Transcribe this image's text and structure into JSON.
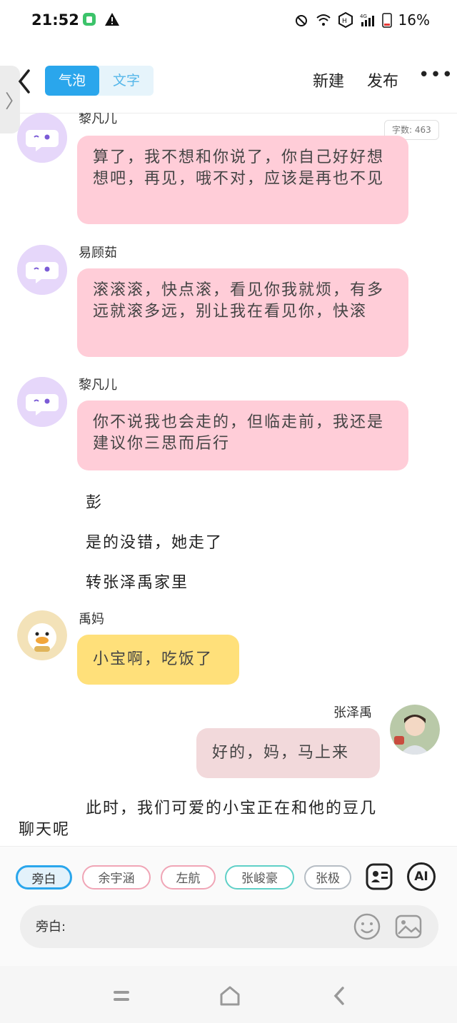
{
  "status_bar": {
    "time": "21:52",
    "battery_percent": "16%",
    "icons": [
      "app-notification-icon",
      "warning-icon",
      "mute-alarm-icon",
      "wifi-icon",
      "hd-icon",
      "signal-4g-icon",
      "battery-icon"
    ]
  },
  "topbar": {
    "segment": {
      "active": "气泡",
      "inactive": "文字"
    },
    "new_label": "新建",
    "publish_label": "发布",
    "more_label": "•••",
    "side_handle_label": "〉"
  },
  "word_count": "字数: 463",
  "messages": [
    {
      "sender": "黎凡儿",
      "text": "算了，我不想和你说了，你自己好好想想吧，再见，哦不对，应该是再也不见"
    },
    {
      "sender": "易顾茹",
      "text": "滚滚滚，快点滚，看见你我就烦，有多远就滚多远，别让我在看见你，快滚"
    },
    {
      "sender": "黎凡儿",
      "text": "你不说我也会走的，但临走前，我还是建议你三思而后行"
    }
  ],
  "narrations": [
    "彭",
    "是的没错，她走了",
    "转张泽禹家里"
  ],
  "mom_message": {
    "sender": "禹妈",
    "text": "小宝啊，吃饭了"
  },
  "reply_message": {
    "sender": "张泽禹",
    "text": "好的，妈，马上来"
  },
  "narration_long": {
    "line1": "此时，我们可爱的小宝正在和他的豆几",
    "line2": "聊天呢"
  },
  "chips": [
    "旁白",
    "余宇涵",
    "左航",
    "张峻豪",
    "张极"
  ],
  "ai_label": "AI",
  "input_label": "旁白:",
  "colors": {
    "accent": "#2aa6ec",
    "bubble_pink": "#ffcdd8",
    "bubble_yellow": "#ffe07a",
    "bubble_rose": "#f2d9db",
    "avatar_purple": "#e6d7fa"
  }
}
